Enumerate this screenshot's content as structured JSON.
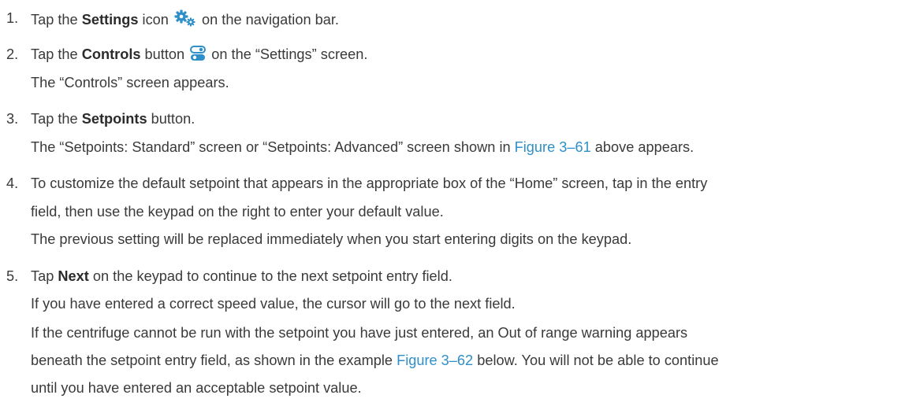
{
  "steps": [
    {
      "number": "1.",
      "main": {
        "pre": "Tap the ",
        "bold": "Settings",
        "mid": " icon",
        "post": " on the navigation bar."
      },
      "icon": "gear-icon"
    },
    {
      "number": "2.",
      "main": {
        "pre": "Tap the ",
        "bold": "Controls",
        "mid": " button",
        "post": " on the “Settings” screen."
      },
      "icon": "toggle-switch-icon",
      "result": "The “Controls” screen appears."
    },
    {
      "number": "3.",
      "main": {
        "pre": "Tap the ",
        "bold": "Setpoints",
        "post": " button."
      },
      "result": {
        "pre": "The “Setpoints: Standard” screen or “Setpoints: Advanced” screen shown in ",
        "link": "Figure 3–61",
        "post": " above appears."
      }
    },
    {
      "number": "4.",
      "line1": "To customize the default setpoint that appears in the appropriate box of the “Home” screen, tap in the entry",
      "line2": "field, then use the keypad on the right to enter your default value.",
      "result": "The previous setting will be replaced immediately when you start entering digits on the keypad."
    },
    {
      "number": "5.",
      "main": {
        "pre": "Tap ",
        "bold": "Next",
        "post": " on the keypad to continue to the next setpoint entry field."
      },
      "result1": "If you have entered a correct speed value, the cursor will go to the next field.",
      "result2_line1": "If the centrifuge cannot be run with the setpoint you have just entered, an Out of range warning appears",
      "result2_line2": {
        "pre": "beneath the setpoint entry field, as shown in the example ",
        "link": "Figure 3–62",
        "post": " below. You will not be able to continue"
      },
      "result2_line3": "until you have entered an acceptable setpoint value."
    }
  ],
  "colors": {
    "text": "#3a3a3a",
    "link": "#2f8fc8",
    "icon": "#2f8fc8"
  }
}
